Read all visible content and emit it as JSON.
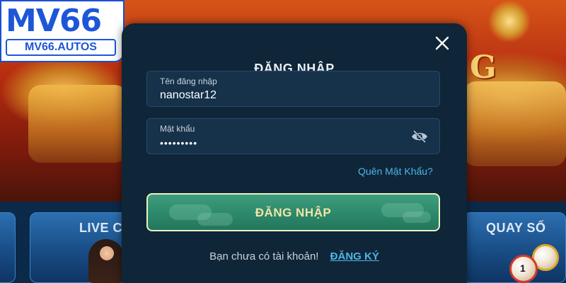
{
  "brand": {
    "logo_text": "MV66",
    "logo_domain": "MV66.AUTOS",
    "logo_color": "#1d56d8"
  },
  "background": {
    "cards": [
      "LIVE C",
      "QUAY SỐ"
    ],
    "ball_number": "1"
  },
  "modal": {
    "title": "ĐĂNG NHẬP",
    "close_icon": "close-icon",
    "username": {
      "label": "Tên đăng nhập",
      "value": "nanostar12"
    },
    "password": {
      "label": "Mật khẩu",
      "masked_value": "•••••••••",
      "toggle_icon": "eye-slash-icon"
    },
    "forgot_password": "Quên Mật Khẩu?",
    "submit_label": "ĐĂNG NHẬP",
    "signup_prompt": "Bạn chưa có tài khoản!",
    "signup_link": "ĐĂNG KÝ"
  },
  "colors": {
    "modal_bg": "#0f2538",
    "field_bg": "#16314a",
    "link": "#4fb6e8",
    "button_green": "#2e8a6c",
    "button_text": "#f2e6a8"
  }
}
